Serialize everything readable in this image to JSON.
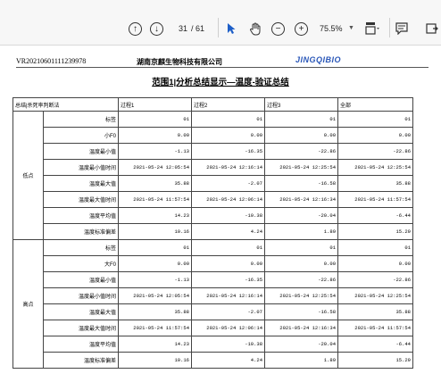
{
  "toolbar": {
    "page_current": "31",
    "page_total": "/ 61",
    "zoom": "75.5%"
  },
  "header": {
    "doc_id": "VR20210601111239978",
    "company": "湖南京麒生物科技有限公司",
    "brand": "JINGQIBIO"
  },
  "title": "范围1|分析总结显示—温度-验证总结",
  "table": {
    "columns": [
      "总结|杀死率判断法",
      "",
      "过程1",
      "过程2",
      "过程3",
      "全部"
    ],
    "groups": [
      {
        "name": "低点",
        "rows": [
          {
            "label": "标签",
            "values": [
              "01",
              "01",
              "01",
              "01"
            ]
          },
          {
            "label": "小F0",
            "values": [
              "0.00",
              "0.00",
              "0.00",
              "0.00"
            ]
          },
          {
            "label": "温度最小值",
            "values": [
              "-1.13",
              "-16.35",
              "-22.86",
              "-22.86"
            ]
          },
          {
            "label": "温度最小值时间",
            "values": [
              "2021-05-24 12:05:54",
              "2021-05-24 12:16:14",
              "2021-05-24 12:25:54",
              "2021-05-24 12:25:54"
            ]
          },
          {
            "label": "温度最大值",
            "values": [
              "35.88",
              "-2.07",
              "-16.58",
              "35.88"
            ]
          },
          {
            "label": "温度最大值时间",
            "values": [
              "2021-05-24 11:57:54",
              "2021-05-24 12:06:14",
              "2021-05-24 12:16:34",
              "2021-05-24 11:57:54"
            ]
          },
          {
            "label": "温度平均值",
            "values": [
              "14.23",
              "-10.38",
              "-20.04",
              "-6.44"
            ]
          },
          {
            "label": "温度标准偏差",
            "values": [
              "10.16",
              "4.24",
              "1.89",
              "15.29"
            ]
          }
        ]
      },
      {
        "name": "高点",
        "rows": [
          {
            "label": "标签",
            "values": [
              "01",
              "01",
              "01",
              "01"
            ]
          },
          {
            "label": "大F0",
            "values": [
              "0.00",
              "0.00",
              "0.00",
              "0.00"
            ]
          },
          {
            "label": "温度最小值",
            "values": [
              "-1.13",
              "-16.35",
              "-22.86",
              "-22.86"
            ]
          },
          {
            "label": "温度最小值时间",
            "values": [
              "2021-05-24 12:05:54",
              "2021-05-24 12:16:14",
              "2021-05-24 12:25:54",
              "2021-05-24 12:25:54"
            ]
          },
          {
            "label": "温度最大值",
            "values": [
              "35.88",
              "-2.07",
              "-16.58",
              "35.88"
            ]
          },
          {
            "label": "温度最大值时间",
            "values": [
              "2021-05-24 11:57:54",
              "2021-05-24 12:06:14",
              "2021-05-24 12:16:34",
              "2021-05-24 11:57:54"
            ]
          },
          {
            "label": "温度平均值",
            "values": [
              "14.23",
              "-10.38",
              "-20.04",
              "-6.44"
            ]
          },
          {
            "label": "温度标准偏差",
            "values": [
              "10.16",
              "4.24",
              "1.89",
              "15.29"
            ]
          }
        ]
      }
    ]
  }
}
